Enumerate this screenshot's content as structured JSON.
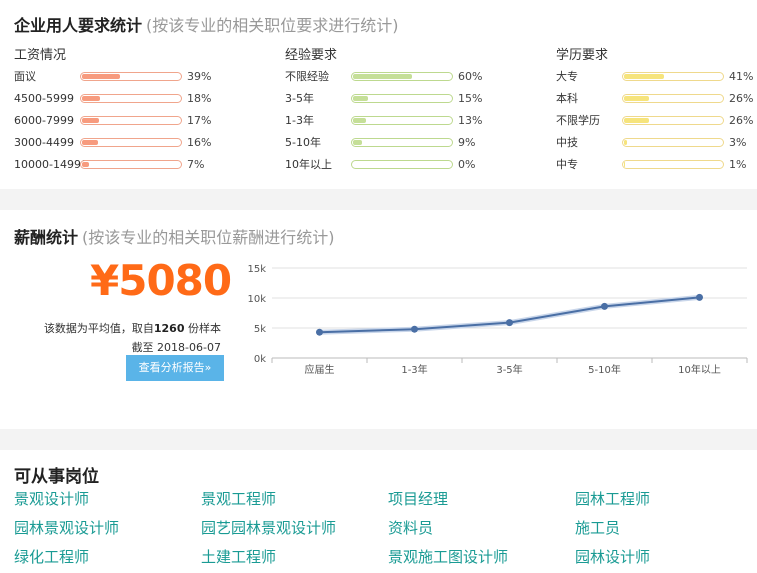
{
  "requirements": {
    "title": "企业用人要求统计",
    "subtitle": "(按该专业的相关职位要求进行统计)",
    "columns": [
      {
        "title": "工资情况",
        "bar_color": "#f79b7e",
        "border_color": "#f0a58c",
        "rows": [
          {
            "label": "面议",
            "pct": "39%",
            "value": 39
          },
          {
            "label": "4500-5999",
            "pct": "18%",
            "value": 18
          },
          {
            "label": "6000-7999",
            "pct": "17%",
            "value": 17
          },
          {
            "label": "3000-4499",
            "pct": "16%",
            "value": 16
          },
          {
            "label": "10000-14999",
            "pct": "7%",
            "value": 7
          }
        ]
      },
      {
        "title": "经验要求",
        "bar_color": "#c5df98",
        "border_color": "#bdd98f",
        "rows": [
          {
            "label": "不限经验",
            "pct": "60%",
            "value": 60
          },
          {
            "label": "3-5年",
            "pct": "15%",
            "value": 15
          },
          {
            "label": "1-3年",
            "pct": "13%",
            "value": 13
          },
          {
            "label": "5-10年",
            "pct": "9%",
            "value": 9
          },
          {
            "label": "10年以上",
            "pct": "0%",
            "value": 0
          }
        ]
      },
      {
        "title": "学历要求",
        "bar_color": "#f6e47c",
        "border_color": "#efd98c",
        "rows": [
          {
            "label": "大专",
            "pct": "41%",
            "value": 41
          },
          {
            "label": "本科",
            "pct": "26%",
            "value": 26
          },
          {
            "label": "不限学历",
            "pct": "26%",
            "value": 26
          },
          {
            "label": "中技",
            "pct": "3%",
            "value": 3
          },
          {
            "label": "中专",
            "pct": "1%",
            "value": 1
          }
        ]
      }
    ]
  },
  "salary": {
    "title": "薪酬统计",
    "subtitle": "(按该专业的相关职位薪酬进行统计)",
    "amount": "¥5080",
    "note_prefix": "该数据为平均值，取自",
    "sample_count": "1260",
    "note_suffix": " 份样本",
    "date_line": "截至 2018-06-07",
    "report_button": "查看分析报告»"
  },
  "chart_data": {
    "type": "line",
    "title": "",
    "xlabel": "",
    "ylabel": "",
    "categories": [
      "应届生",
      "1-3年",
      "3-5年",
      "5-10年",
      "10年以上"
    ],
    "series": [
      {
        "values": [
          4300,
          4800,
          5900,
          8600,
          10100
        ]
      }
    ],
    "ylim": [
      0,
      15000
    ],
    "yticks": [
      0,
      5000,
      10000,
      15000
    ],
    "ytick_labels": [
      "0k",
      "5k",
      "10k",
      "15k"
    ],
    "grid": true,
    "line_color": "#4a6fa5"
  },
  "jobs": {
    "title": "可从事岗位",
    "items": [
      "景观设计师",
      "景观工程师",
      "项目经理",
      "园林工程师",
      "园林景观设计师",
      "园艺园林景观设计师",
      "资料员",
      "施工员",
      "绿化工程师",
      "土建工程师",
      "景观施工图设计师",
      "园林设计师"
    ]
  }
}
